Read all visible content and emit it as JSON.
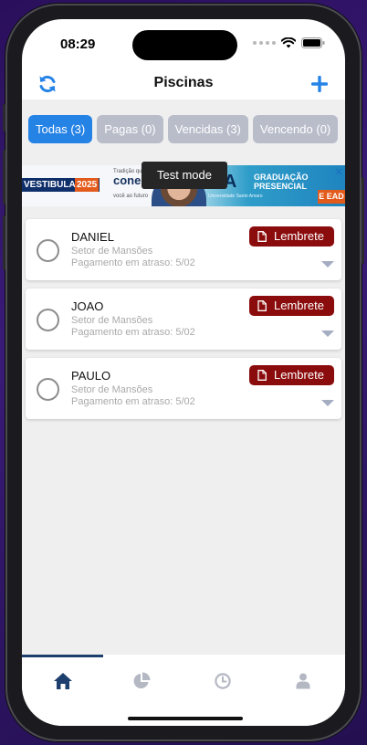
{
  "status_bar": {
    "time": "08:29"
  },
  "header": {
    "title": "Piscinas",
    "left_icon": "refresh-icon",
    "right_icon": "plus-icon"
  },
  "colors": {
    "accent": "#2683e6",
    "chip_inactive": "#b9bdca",
    "lembrete": "#8b0c0c",
    "tab_active": "#1d3f6e",
    "tab_inactive": "#b4b8c3"
  },
  "filters": [
    {
      "label": "Todas",
      "count": "(3)",
      "active": true
    },
    {
      "label": "Pagas",
      "count": "(0)",
      "active": false
    },
    {
      "label": "Vencidas",
      "count": "(3)",
      "active": false
    },
    {
      "label": "Vencendo",
      "count": "(0)",
      "active": false
    }
  ],
  "ad": {
    "brand_left": "VESTIBULAR",
    "year": "2025",
    "tagline_small": "Tradição que",
    "tagline_big": "conect",
    "tagline_bottom": "você ao futuro",
    "logo": "ISA",
    "logo_sub": "Universidade Santo Amaro",
    "graduacao": "GRADUAÇÃO PRESENCIAL",
    "ead": "E EAD",
    "test_mode": "Test mode"
  },
  "clients": [
    {
      "name": "DANIEL",
      "sector": "Setor de Mansões",
      "status": "Pagamento em atraso: 5/02",
      "button": "Lembrete"
    },
    {
      "name": "JOAO",
      "sector": "Setor de Mansões",
      "status": "Pagamento em atraso: 5/02",
      "button": "Lembrete"
    },
    {
      "name": "PAULO",
      "sector": "Setor de Mansões",
      "status": "Pagamento em atraso: 5/02",
      "button": "Lembrete"
    }
  ],
  "tabs": [
    {
      "icon": "home-icon",
      "active": true
    },
    {
      "icon": "pie-chart-icon",
      "active": false
    },
    {
      "icon": "clock-icon",
      "active": false
    },
    {
      "icon": "user-icon",
      "active": false
    }
  ]
}
